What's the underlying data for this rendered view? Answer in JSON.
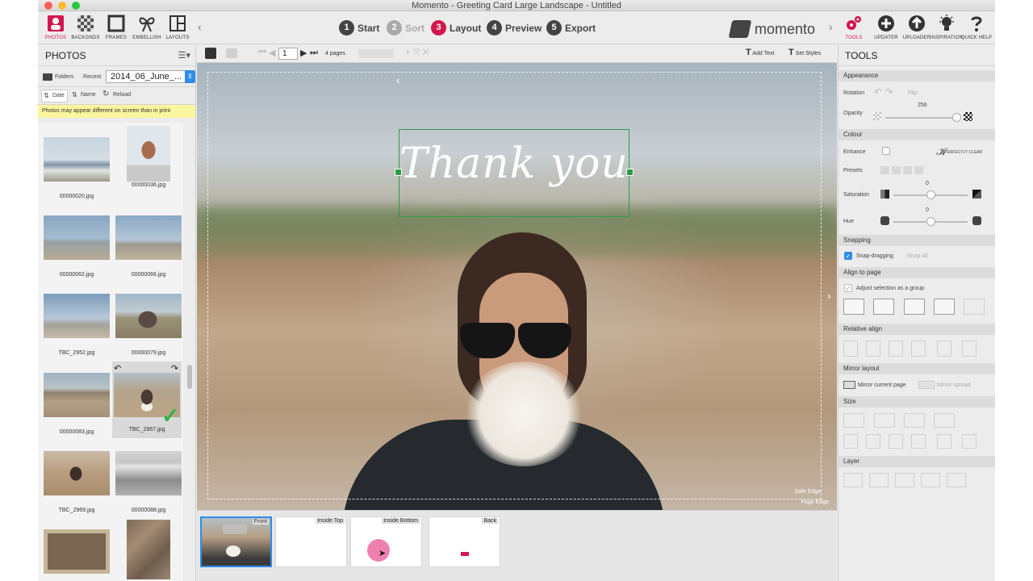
{
  "window": {
    "title": "Momento - Greeting Card Large Landscape - Untitled"
  },
  "toolbar": {
    "left_tools": [
      "PHOTOS",
      "BACKGNDS",
      "FRAMES",
      "EMBELLISH",
      "LAYOUTS"
    ],
    "steps": [
      {
        "num": "1",
        "label": "Start"
      },
      {
        "num": "2",
        "label": "Sort"
      },
      {
        "num": "3",
        "label": "Layout"
      },
      {
        "num": "4",
        "label": "Preview"
      },
      {
        "num": "5",
        "label": "Export"
      }
    ],
    "brand": "momento",
    "right_tools": [
      "TOOLS",
      "UPDATER",
      "UPLOADER",
      "INSPIRATION",
      "QUICK HELP"
    ]
  },
  "photos_panel": {
    "title": "PHOTOS",
    "folders_label": "Folders",
    "recent_label": "Recent",
    "folder_value": "2014_06_June_...",
    "sort_date": "Date",
    "sort_name": "Name",
    "reload": "Reload",
    "warning": "Photos may appear different on screen than in print",
    "photos": [
      {
        "name": "00000020.jpg"
      },
      {
        "name": "00000036.jpg"
      },
      {
        "name": "00000062.jpg"
      },
      {
        "name": "00000066.jpg"
      },
      {
        "name": "TBC_2952.jpg"
      },
      {
        "name": "00000079.jpg"
      },
      {
        "name": "00000083.jpg"
      },
      {
        "name": "TBC_2967.jpg"
      },
      {
        "name": "TBC_2969.jpg"
      },
      {
        "name": "00000088.jpg"
      },
      {
        "name": ""
      },
      {
        "name": ""
      }
    ]
  },
  "canvas": {
    "page_number": "1",
    "page_count": "4 pages",
    "add_text": "Add Text",
    "set_styles": "Set Styles",
    "card_text": "Thank you",
    "safe_edge": "Safe Edge",
    "page_edge": "Page Edge"
  },
  "pages": [
    "Front",
    "Inside Top",
    "Inside Bottom",
    "Back"
  ],
  "tools_panel": {
    "title": "TOOLS",
    "appearance": "Appearance",
    "rotation": "Rotation",
    "rotation_action": "Flip",
    "opacity": "Opacity",
    "opacity_value": "256",
    "opacity_level": 1.0,
    "colour": "Colour",
    "enhance": "Enhance",
    "perfectly_clear": "PERFECTLY CLEAR",
    "presets": "Presets",
    "saturation": "Saturation",
    "saturation_value": "0",
    "hue": "Hue",
    "hue_value": "0",
    "snapping": "Snapping",
    "snap_dragging": "Snap-dragging",
    "snap_all": "Snap all",
    "align_to_page": "Align to page",
    "adjust_group": "Adjust selection as a group",
    "relative_align": "Relative align",
    "mirror_layout": "Mirror layout",
    "mirror_current": "Mirror current page",
    "mirror_spread": "Mirror spread",
    "size": "Size",
    "layer": "Layer"
  },
  "colors": {
    "accent": "#d2174e",
    "selection": "#2e9a4a",
    "warning_bg": "#fbf59e"
  }
}
